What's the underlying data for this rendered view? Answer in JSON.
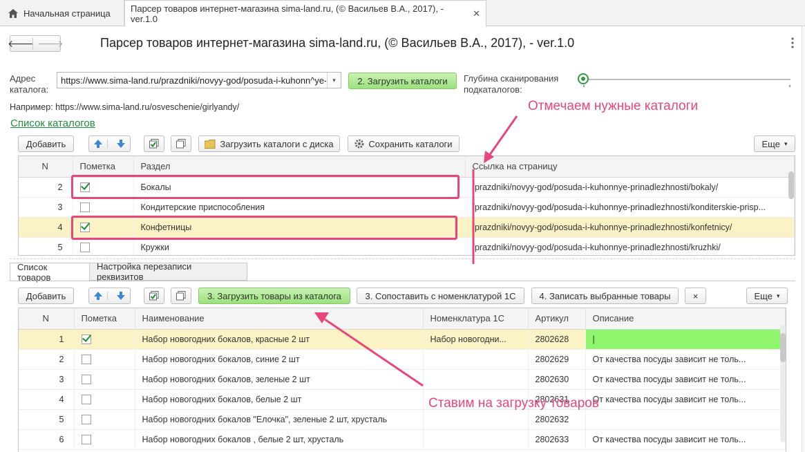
{
  "tabs": {
    "home": "Начальная страница",
    "document": "Парсер товаров интернет-магазина sima-land.ru, (© Васильев В.А., 2017), - ver.1.0",
    "close": "✕"
  },
  "nav": {
    "back": "🡐",
    "forward": "🡒"
  },
  "form": {
    "title": "Парсер товаров интернет-магазина sima-land.ru, (© Васильев В.А., 2017), - ver.1.0",
    "catalog_address_label": "Адрес каталога:",
    "catalog_address_value": "https://www.sima-land.ru/prazdniki/novyy-god/posuda-i-kuhonn^ye-",
    "load_catalogs_button": "2. Загрузить каталоги",
    "depth_label": "Глубина сканирования подкаталогов:",
    "example": "Например: https://www.sima-land.ru/osveschenie/girlyandy/",
    "catalog_list_link": "Список каталогов"
  },
  "catalog_toolbar": {
    "add": "Добавить",
    "load_from_disk": "Загрузить каталоги с диска",
    "save": "Сохранить каталоги",
    "more": "Еще"
  },
  "catalog_table": {
    "headers": [
      "N",
      "Пометка",
      "Раздел",
      "Ссылка на страницу"
    ],
    "rows": [
      {
        "n": "2",
        "checked": true,
        "section": "Бокалы",
        "link": "/prazdniki/novyy-god/posuda-i-kuhonnye-prinadlezhnosti/bokaly/"
      },
      {
        "n": "3",
        "checked": false,
        "section": "Кондитерские приспособления",
        "link": "/prazdniki/novyy-god/posuda-i-kuhonnye-prinadlezhnosti/konditerskie-prisp..."
      },
      {
        "n": "4",
        "checked": true,
        "section": "Конфетницы",
        "link": "/prazdniki/novyy-god/posuda-i-kuhonnye-prinadlezhnosti/konfetnicy/"
      },
      {
        "n": "5",
        "checked": false,
        "section": "Кружки",
        "link": "/prazdniki/novyy-god/posuda-i-kuhonnye-prinadlezhnosti/kruzhki/"
      }
    ]
  },
  "lower_tabs": [
    "Список товаров",
    "Настройка перезаписи реквизитов"
  ],
  "products_toolbar": {
    "add": "Добавить",
    "load_products": "3. Загрузить товары из каталога",
    "match": "3. Сопоставить с номенклатурой 1С",
    "write": "4. Записать выбранные товары",
    "clear": "×",
    "more": "Еще"
  },
  "products_table": {
    "headers": [
      "N",
      "Пометка",
      "Наименование",
      "Номенклатура 1С",
      "Артикул",
      "Описание"
    ],
    "rows": [
      {
        "n": "1",
        "checked": true,
        "name": "Набор новогодних бокалов, красные 2 шт",
        "nomenclature": "Набор новогодни...",
        "article": "2802628",
        "description": "|"
      },
      {
        "n": "2",
        "checked": false,
        "name": "Набор новогодних бокалов, синие 2 шт",
        "nomenclature": "",
        "article": "2802629",
        "description": "От качества посуды зависит не толь..."
      },
      {
        "n": "3",
        "checked": false,
        "name": "Набор новогодних бокалов, зеленые 2 шт",
        "nomenclature": "",
        "article": "2802630",
        "description": "От качества посуды зависит не толь..."
      },
      {
        "n": "4",
        "checked": false,
        "name": "Набор новогодних бокалов, белые 2 шт",
        "nomenclature": "",
        "article": "2802631",
        "description": "От качества посуды зависит не толь..."
      },
      {
        "n": "5",
        "checked": false,
        "name": "Набор новогодних бокалов \"Елочка\", зеленые 2 шт, хрусталь",
        "nomenclature": "",
        "article": "2802632",
        "description": ""
      },
      {
        "n": "6",
        "checked": false,
        "name": "Набор новогодних бокалов , белые 2 шт, хрусталь",
        "nomenclature": "",
        "article": "2802633",
        "description": "От качества посуды зависит не толь..."
      }
    ]
  },
  "annotations": {
    "mark_catalogs": "Отмечаем нужные каталоги",
    "start_loading": "Ставим на загрузку товаров"
  },
  "colors": {
    "accent_green": "#9be27b",
    "annotation": "#e8467a",
    "selected_row": "#fbf3c6"
  }
}
